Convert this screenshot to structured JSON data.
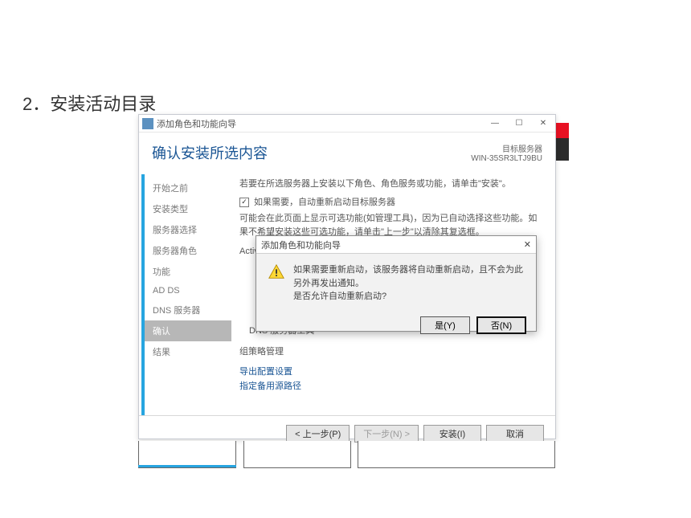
{
  "doc": {
    "heading": "2．安装活动目录"
  },
  "window": {
    "title": "添加角色和功能向导",
    "ctrl": {
      "min": "—",
      "max": "☐",
      "close": "✕"
    }
  },
  "header": {
    "page_title": "确认安装所选内容",
    "server_label": "目标服务器",
    "server_name": "WIN-35SR3LTJ9BU"
  },
  "sidebar": {
    "items": [
      "开始之前",
      "安装类型",
      "服务器选择",
      "服务器角色",
      "功能",
      "AD DS",
      "DNS 服务器",
      "确认",
      "结果"
    ],
    "active_index": 7
  },
  "content": {
    "instruction": "若要在所选服务器上安装以下角色、角色服务或功能，请单击\"安装\"。",
    "checkbox_label": "如果需要，自动重新启动目标服务器",
    "warning": "可能会在此页面上显示可选功能(如管理工具)，因为已自动选择这些功能。如果不希望安装这些可选功能，请单击\"上一步\"以清除其复选框。",
    "features": [
      "Active Directory 域服务",
      "DNS 服务器工具",
      "组策略管理"
    ],
    "links": {
      "export": "导出配置设置",
      "altpath": "指定备用源路径"
    }
  },
  "footer": {
    "prev": "< 上一步(P)",
    "next": "下一步(N) >",
    "install": "安装(I)",
    "cancel": "取消"
  },
  "modal": {
    "title": "添加角色和功能向导",
    "close": "✕",
    "message_line1": "如果需要重新启动，该服务器将自动重新启动，且不会为此另外再发出通知。",
    "message_line2": "是否允许自动重新启动?",
    "yes": "是(Y)",
    "no": "否(N)"
  }
}
